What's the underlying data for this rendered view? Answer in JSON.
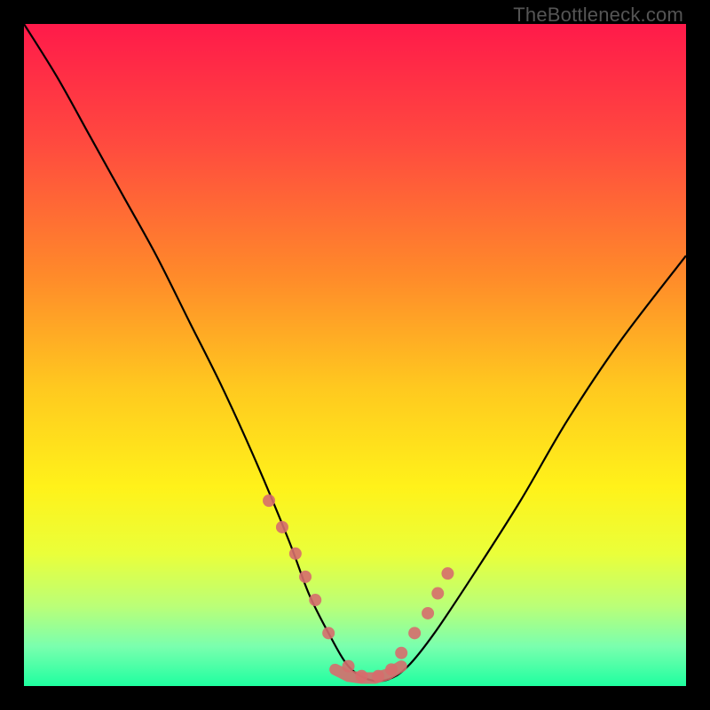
{
  "watermark": "TheBottleneck.com",
  "chart_data": {
    "type": "line",
    "title": "",
    "xlabel": "",
    "ylabel": "",
    "xlim": [
      0,
      100
    ],
    "ylim": [
      0,
      100
    ],
    "series": [
      {
        "name": "bottleneck-curve",
        "x": [
          0,
          5,
          10,
          15,
          20,
          25,
          30,
          35,
          40,
          43,
          46,
          49,
          52,
          55,
          58,
          62,
          68,
          75,
          82,
          90,
          100
        ],
        "values": [
          100,
          92,
          83,
          74,
          65,
          55,
          45,
          34,
          22,
          14,
          8,
          3,
          1,
          1,
          3,
          8,
          17,
          28,
          40,
          52,
          65
        ]
      }
    ],
    "markers": {
      "name": "highlighted-points",
      "color": "#d66d6d",
      "x": [
        37,
        39,
        41,
        42.5,
        44,
        46,
        49,
        51,
        53.5,
        55.5,
        57,
        59,
        61,
        62.5,
        64
      ],
      "values": [
        28,
        24,
        20,
        16.5,
        13,
        8,
        3,
        1.5,
        1.5,
        2.5,
        5,
        8,
        11,
        14,
        17
      ]
    },
    "gradient_stops": [
      {
        "offset": 0.0,
        "color": "#ff1a4a"
      },
      {
        "offset": 0.18,
        "color": "#ff4a3f"
      },
      {
        "offset": 0.38,
        "color": "#ff8a2a"
      },
      {
        "offset": 0.55,
        "color": "#ffc91f"
      },
      {
        "offset": 0.7,
        "color": "#fff21a"
      },
      {
        "offset": 0.8,
        "color": "#eaff3a"
      },
      {
        "offset": 0.88,
        "color": "#baff78"
      },
      {
        "offset": 0.94,
        "color": "#7affae"
      },
      {
        "offset": 1.0,
        "color": "#1fffa0"
      }
    ]
  }
}
